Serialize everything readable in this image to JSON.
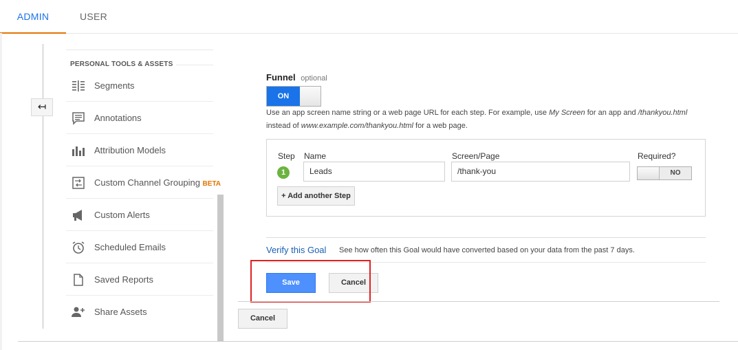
{
  "tabs": {
    "admin": "ADMIN",
    "user": "USER"
  },
  "sidebar": {
    "section_title": "PERSONAL TOOLS & ASSETS",
    "items": [
      {
        "label": "Segments",
        "icon": "segments-icon"
      },
      {
        "label": "Annotations",
        "icon": "annotations-icon"
      },
      {
        "label": "Attribution Models",
        "icon": "bar-chart-icon"
      },
      {
        "label": "Custom Channel Grouping",
        "badge": "BETA",
        "icon": "channel-grouping-icon"
      },
      {
        "label": "Custom Alerts",
        "icon": "megaphone-icon"
      },
      {
        "label": "Scheduled Emails",
        "icon": "alarm-clock-icon"
      },
      {
        "label": "Saved Reports",
        "icon": "document-icon"
      },
      {
        "label": "Share Assets",
        "icon": "add-user-icon"
      }
    ]
  },
  "back_button": {
    "icon": "back-arrow-icon",
    "glyph": "↤"
  },
  "funnel": {
    "label": "Funnel",
    "optional": "optional",
    "toggle": "ON",
    "help_1": "Use an app screen name string or a web page URL for each step. For example, use ",
    "help_em_1": "My Screen",
    "help_2": " for an app and ",
    "help_em_2": "/thankyou.html",
    "help_3": "instead of ",
    "help_em_3": "www.example.com/thankyou.html",
    "help_4": " for a web page."
  },
  "steps": {
    "headers": {
      "step": "Step",
      "name": "Name",
      "screen": "Screen/Page",
      "required": "Required?"
    },
    "rows": [
      {
        "number": "1",
        "name": "Leads",
        "screen": "/thank-you",
        "required": "NO"
      }
    ],
    "add_step": "+ Add another Step"
  },
  "verify": {
    "link": "Verify this Goal",
    "text": "See how often this Goal would have converted based on your data from the past 7 days."
  },
  "buttons": {
    "save": "Save",
    "cancel": "Cancel",
    "cancel_outer": "Cancel"
  },
  "colors": {
    "accent": "#1a73e8",
    "save": "#4d90fe",
    "highlight": "#e02020",
    "tab_underline": "#e37400"
  }
}
